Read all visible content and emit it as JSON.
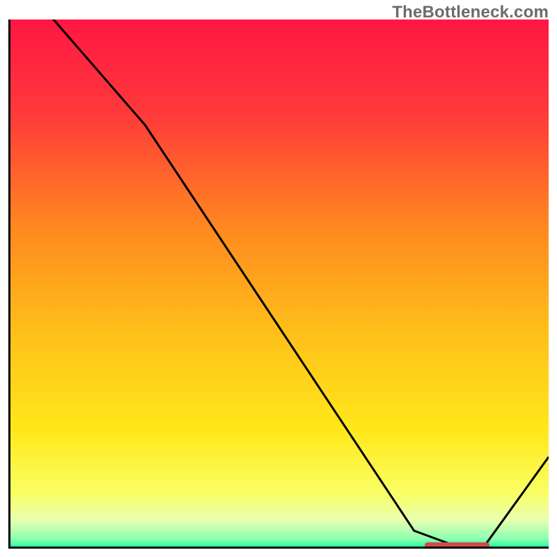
{
  "watermark": "TheBottleneck.com",
  "colors": {
    "axis": "#000000",
    "curve": "#000000",
    "marker": "#d04a4a",
    "gradient_stops": [
      {
        "offset": 0.0,
        "color": "#ff1744"
      },
      {
        "offset": 0.18,
        "color": "#ff3a3a"
      },
      {
        "offset": 0.4,
        "color": "#ff8a1f"
      },
      {
        "offset": 0.6,
        "color": "#ffc11a"
      },
      {
        "offset": 0.78,
        "color": "#ffe81a"
      },
      {
        "offset": 0.9,
        "color": "#faff66"
      },
      {
        "offset": 0.95,
        "color": "#e8ffb0"
      },
      {
        "offset": 0.985,
        "color": "#8dffb0"
      },
      {
        "offset": 1.0,
        "color": "#2bffa0"
      }
    ]
  },
  "chart_data": {
    "type": "line",
    "title": "",
    "xlabel": "",
    "ylabel": "",
    "xlim": [
      0,
      100
    ],
    "ylim": [
      0,
      100
    ],
    "grid": false,
    "x": [
      0,
      8,
      25,
      75,
      83,
      88,
      100
    ],
    "series": [
      {
        "name": "curve",
        "values": [
          108,
          100,
          80,
          3,
          0,
          0,
          17
        ]
      }
    ],
    "annotations": [
      {
        "kind": "marker-segment",
        "x0": 77,
        "x1": 89,
        "y": 0
      }
    ]
  }
}
